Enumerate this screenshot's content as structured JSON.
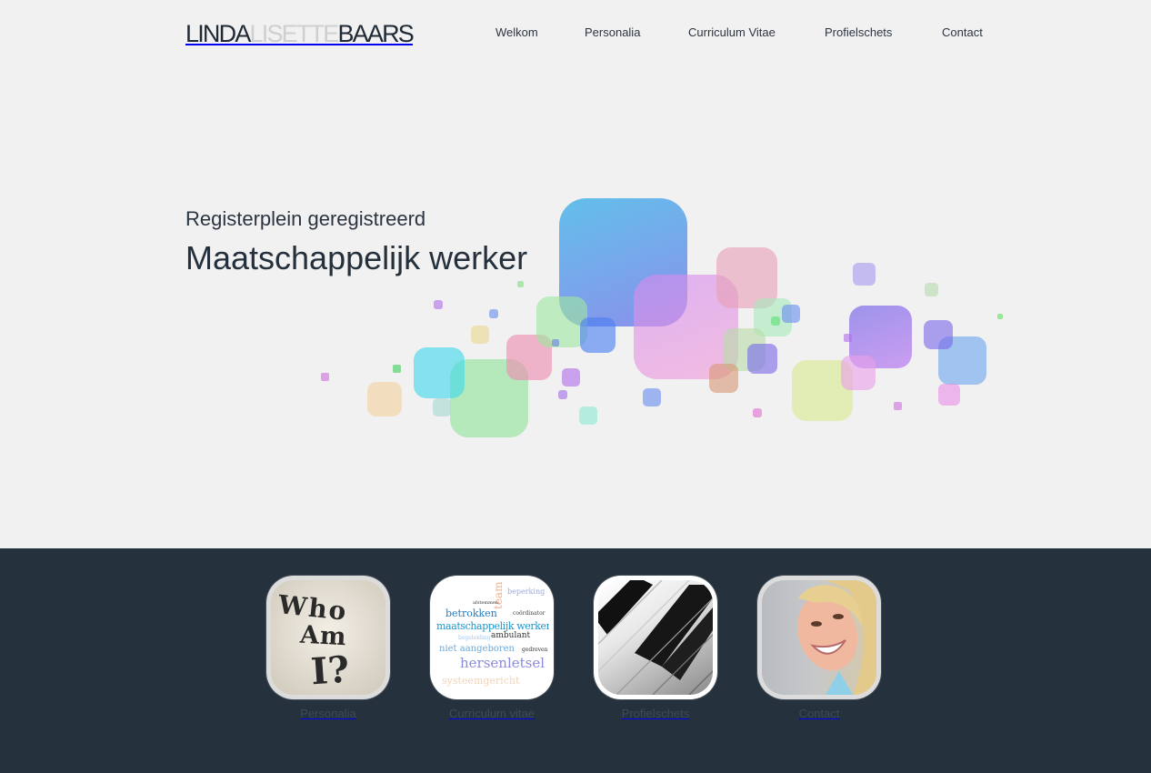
{
  "logo": {
    "first": "LINDA",
    "middle": "LISETTE",
    "last": "BAARS"
  },
  "nav": {
    "items": [
      {
        "label": "Welkom"
      },
      {
        "label": "Personalia"
      },
      {
        "label": "Curriculum Vitae"
      },
      {
        "label": "Profielschets"
      },
      {
        "label": "Contact"
      }
    ]
  },
  "hero": {
    "subtitle": "Registerplein geregistreerd",
    "title": "Maatschappelijk werker"
  },
  "tiles": [
    {
      "label": "Personalia",
      "image": "who-am-i-image",
      "words": [
        "Who",
        "Am",
        "I?"
      ]
    },
    {
      "label": "Curriculum vitae",
      "image": "word-cloud-image",
      "words": [
        "team",
        "beperking",
        "afstemmen",
        "betrokken",
        "coördinator",
        "maatschappelijk werker",
        "begeleiding",
        "ambulant",
        "niet aangeboren",
        "gedreven",
        "hersenletsel",
        "systeemgericht"
      ]
    },
    {
      "label": "Profielschets",
      "image": "piano-keys-image"
    },
    {
      "label": "Contact",
      "image": "portrait-photo"
    }
  ],
  "colors": {
    "background": "#f1f1f1",
    "footer": "#25313c",
    "text_dark": "#24303c",
    "logo_light": "#cfcfcf"
  }
}
